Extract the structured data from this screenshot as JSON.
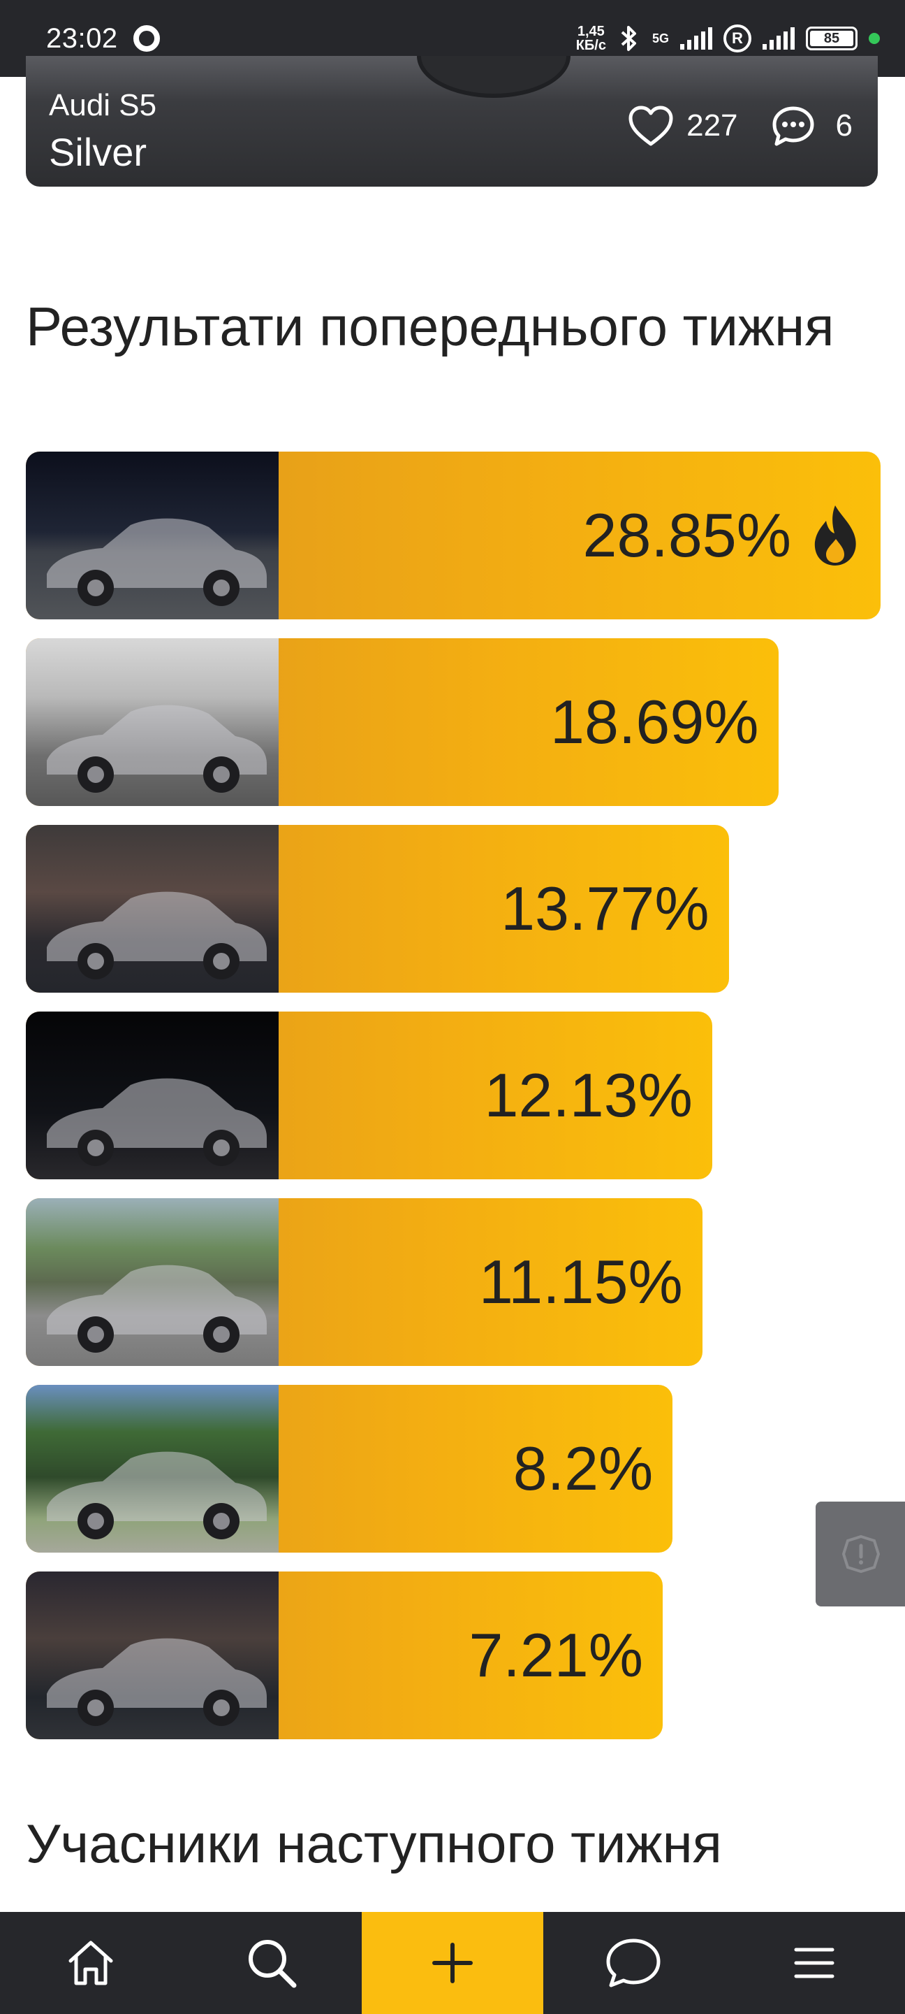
{
  "status_bar": {
    "time": "23:02",
    "network_speed": "1,45",
    "network_speed_unit": "КБ/с",
    "network_type": "5G",
    "roaming_badge": "R",
    "battery_level": "85",
    "icons": [
      "record-icon",
      "bluetooth-icon",
      "signal-icon",
      "battery-icon"
    ]
  },
  "previous_card": {
    "car_name": "Audi S5",
    "car_color": "Silver",
    "likes_count": "227",
    "comments_count": "6"
  },
  "results_section": {
    "title": "Результати попереднього тижня",
    "entries": [
      {
        "percent": 28.85,
        "percent_label": "28.85%",
        "is_leader": true
      },
      {
        "percent": 18.69,
        "percent_label": "18.69%",
        "is_leader": false
      },
      {
        "percent": 13.77,
        "percent_label": "13.77%",
        "is_leader": false
      },
      {
        "percent": 12.13,
        "percent_label": "12.13%",
        "is_leader": false
      },
      {
        "percent": 11.15,
        "percent_label": "11.15%",
        "is_leader": false
      },
      {
        "percent": 8.2,
        "percent_label": "8.2%",
        "is_leader": false
      },
      {
        "percent": 7.21,
        "percent_label": "7.21%",
        "is_leader": false
      }
    ]
  },
  "next_section": {
    "title": "Учасники наступного тижня"
  },
  "bottom_nav": {
    "items": [
      "home-icon",
      "search-icon",
      "plus-icon",
      "chat-icon",
      "menu-icon"
    ]
  },
  "colors": {
    "accent": "#fbbd0f",
    "bar_start": "#dd951f",
    "bar_end": "#fbbf0a",
    "nav_background": "#26272b"
  }
}
